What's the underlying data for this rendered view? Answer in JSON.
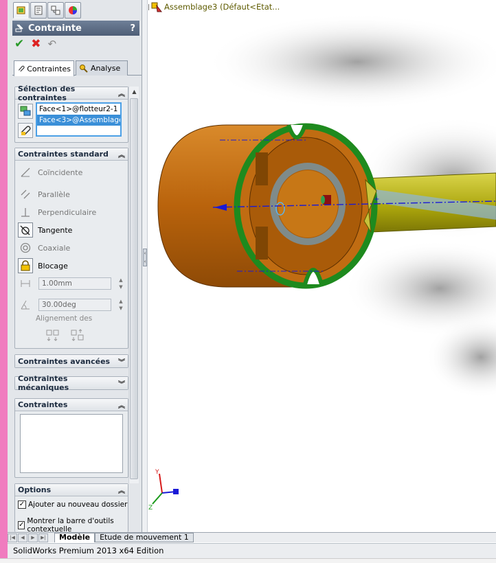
{
  "property_manager": {
    "title": "Contrainte",
    "help": "?",
    "tabs": [
      {
        "label": "Contraintes"
      },
      {
        "label": "Analyse"
      }
    ]
  },
  "selection": {
    "header": "Sélection des contraintes",
    "items": [
      "Face<1>@flotteur2-1",
      "Face<3>@Assemblage"
    ]
  },
  "standard": {
    "header": "Contraintes standard",
    "items": [
      {
        "label": "Coïncidente",
        "enabled": false
      },
      {
        "label": "Parallèle",
        "enabled": false
      },
      {
        "label": "Perpendiculaire",
        "enabled": false
      },
      {
        "label": "Tangente",
        "enabled": true
      },
      {
        "label": "Coaxiale",
        "enabled": false
      },
      {
        "label": "Blocage",
        "enabled": true
      }
    ],
    "distance_value": "1.00mm",
    "angle_value": "30.00deg",
    "alignment_label": "Alignement des"
  },
  "advanced": {
    "header": "Contraintes avancées"
  },
  "mechanical": {
    "header": "Contraintes mécaniques"
  },
  "mates_list": {
    "header": "Contraintes"
  },
  "options": {
    "header": "Options",
    "items": [
      {
        "label": "Ajouter au nouveau dossier",
        "checked": true
      },
      {
        "label": "Montrer la barre d'outils contextuelle",
        "checked": true
      }
    ]
  },
  "viewport": {
    "tree_label": "Assemblage3  (Défaut<Etat..."
  },
  "bottom_tabs": [
    "Modèle",
    "Etude de mouvement 1"
  ],
  "status": "SolidWorks Premium 2013 x64 Edition",
  "colors": {
    "part_body": "#c56f12",
    "ring": "#1e8a1e",
    "shaft": "#b8b30c",
    "axis": "#1a1ad6"
  }
}
